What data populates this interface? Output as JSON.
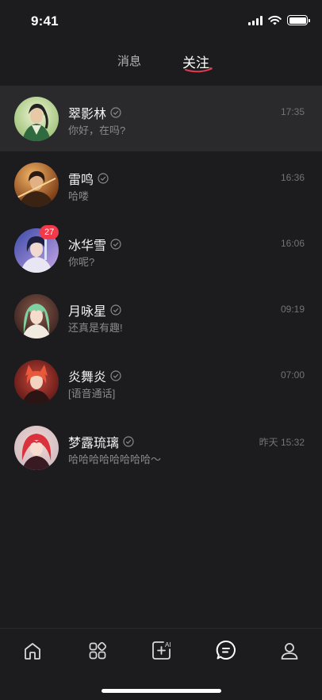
{
  "status_bar": {
    "time": "9:41"
  },
  "tabs": [
    {
      "label": "消息",
      "active": false
    },
    {
      "label": "关注",
      "active": true
    }
  ],
  "colors": {
    "background": "#1c1c1e",
    "active_row": "#2a2a2c",
    "badge": "#f2394a",
    "underline": "#e53a4f"
  },
  "chats": [
    {
      "name": "翠影林",
      "time": "17:35",
      "preview": "你好，在吗?",
      "verified": true,
      "badge": null,
      "active": true,
      "avatar": "avatar-green-robed-man"
    },
    {
      "name": "雷鸣",
      "time": "16:36",
      "preview": "哈喽",
      "verified": true,
      "badge": null,
      "active": false,
      "avatar": "avatar-warrior-orange"
    },
    {
      "name": "冰华雪",
      "time": "16:06",
      "preview": "你呢?",
      "verified": true,
      "badge": "27",
      "active": false,
      "avatar": "avatar-blue-white-girl"
    },
    {
      "name": "月咏星",
      "time": "09:19",
      "preview": "还真是有趣!",
      "verified": true,
      "badge": null,
      "active": false,
      "avatar": "avatar-green-haired-girl"
    },
    {
      "name": "炎舞炎",
      "time": "07:00",
      "preview": "[语音通话]",
      "verified": true,
      "badge": null,
      "active": false,
      "avatar": "avatar-red-fox-girl"
    },
    {
      "name": "梦露琉璃",
      "time": "昨天 15:32",
      "preview": "哈哈哈哈哈哈哈哈～",
      "verified": true,
      "badge": null,
      "active": false,
      "avatar": "avatar-red-haired-girl"
    }
  ],
  "tab_bar": [
    {
      "icon": "home-icon"
    },
    {
      "icon": "apps-grid-icon"
    },
    {
      "icon": "ai-create-icon",
      "label": "AI"
    },
    {
      "icon": "chat-icon",
      "active": true
    },
    {
      "icon": "profile-icon"
    }
  ]
}
